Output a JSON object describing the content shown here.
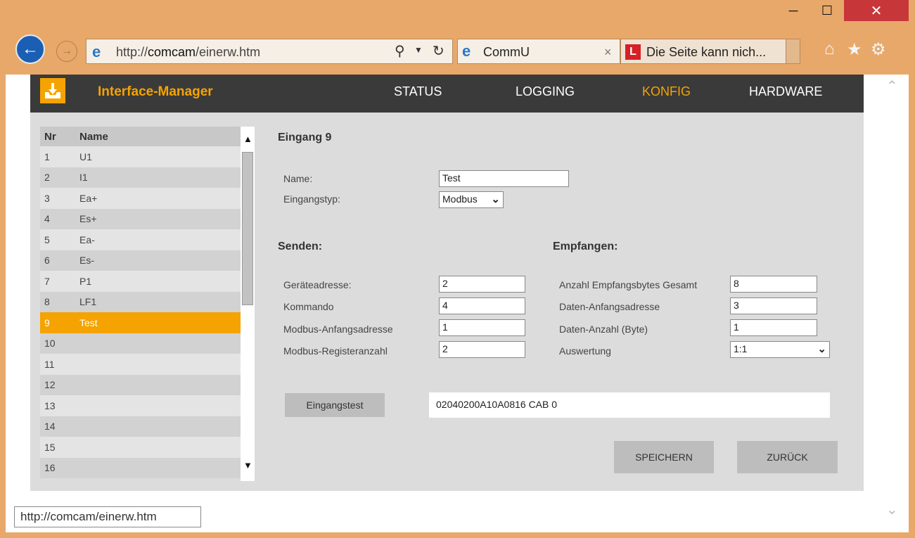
{
  "browser": {
    "address_url_prefix": "http://",
    "address_url_host": "comcam",
    "address_url_path": "/einerw.htm",
    "tab1_title": "CommU",
    "tab2_title": "Die Seite kann nich...",
    "tab2_icon_letter": "L",
    "status_url": "http://comcam/einerw.htm"
  },
  "app": {
    "brand": "Interface-Manager",
    "nav": [
      "STATUS",
      "LOGGING",
      "KONFIG",
      "HARDWARE"
    ],
    "active_nav": "KONFIG",
    "accent_color": "#f5a300"
  },
  "list": {
    "col_nr": "Nr",
    "col_name": "Name",
    "rows": [
      {
        "nr": "1",
        "name": "U1"
      },
      {
        "nr": "2",
        "name": "I1"
      },
      {
        "nr": "3",
        "name": "Ea+"
      },
      {
        "nr": "4",
        "name": "Es+"
      },
      {
        "nr": "5",
        "name": "Ea-"
      },
      {
        "nr": "6",
        "name": "Es-"
      },
      {
        "nr": "7",
        "name": "P1"
      },
      {
        "nr": "8",
        "name": "LF1"
      },
      {
        "nr": "9",
        "name": "Test"
      },
      {
        "nr": "10",
        "name": ""
      },
      {
        "nr": "11",
        "name": ""
      },
      {
        "nr": "12",
        "name": ""
      },
      {
        "nr": "13",
        "name": ""
      },
      {
        "nr": "14",
        "name": ""
      },
      {
        "nr": "15",
        "name": ""
      },
      {
        "nr": "16",
        "name": ""
      }
    ],
    "selected_nr": "9"
  },
  "form": {
    "title": "Eingang 9",
    "name_label": "Name:",
    "name_value": "Test",
    "type_label": "Eingangstyp:",
    "type_value": "Modbus",
    "send_title": "Senden:",
    "recv_title": "Empfangen:",
    "send": [
      {
        "label": "Geräteadresse:",
        "value": "2"
      },
      {
        "label": "Kommando",
        "value": "4"
      },
      {
        "label": "Modbus-Anfangsadresse",
        "value": "1"
      },
      {
        "label": "Modbus-Registeranzahl",
        "value": "2"
      }
    ],
    "recv": [
      {
        "label": "Anzahl Empfangsbytes Gesamt",
        "value": "8"
      },
      {
        "label": "Daten-Anfangsadresse",
        "value": "3"
      },
      {
        "label": "Daten-Anzahl (Byte)",
        "value": "1"
      },
      {
        "label": "Auswertung",
        "value": "1:1"
      }
    ],
    "test_button": "Eingangstest",
    "test_output": "02040200A10A0816 CAB 0",
    "save_button": "SPEICHERN",
    "back_button": "ZURÜCK"
  }
}
